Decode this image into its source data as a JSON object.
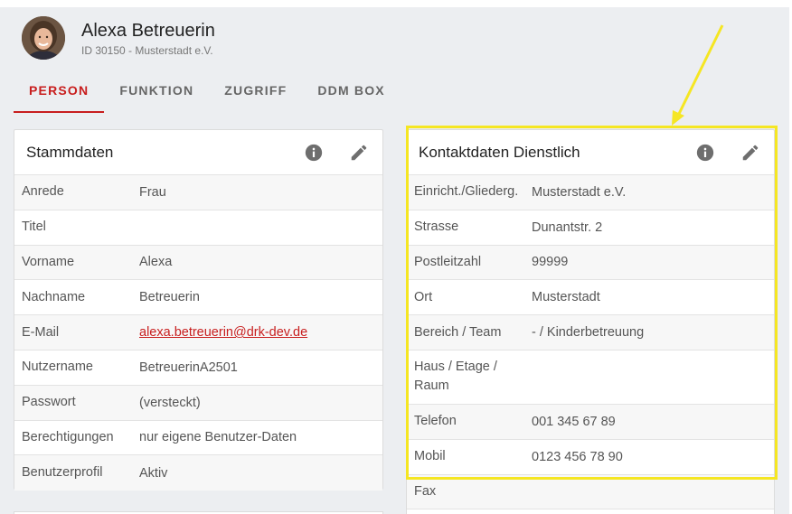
{
  "user": {
    "name": "Alexa Betreuerin",
    "subtitle": "ID 30150 - Musterstadt e.V."
  },
  "tabs": [
    {
      "label": "PERSON",
      "active": true
    },
    {
      "label": "FUNKTION",
      "active": false
    },
    {
      "label": "ZUGRIFF",
      "active": false
    },
    {
      "label": "DDM BOX",
      "active": false
    }
  ],
  "stammdaten": {
    "title": "Stammdaten",
    "icons": [
      "info-icon",
      "edit-icon"
    ],
    "rows": [
      {
        "label": "Anrede",
        "value": "Frau"
      },
      {
        "label": "Titel",
        "value": ""
      },
      {
        "label": "Vorname",
        "value": "Alexa"
      },
      {
        "label": "Nachname",
        "value": "Betreuerin"
      },
      {
        "label": "E-Mail",
        "value": "alexa.betreuerin@drk-dev.de"
      },
      {
        "label": "Nutzername",
        "value": "BetreuerinA2501"
      },
      {
        "label": "Passwort",
        "value": "(versteckt)"
      },
      {
        "label": "Berechtigungen",
        "value": "nur eigene Benutzer-Daten"
      },
      {
        "label": "Benutzerprofil",
        "value": "Aktiv"
      }
    ]
  },
  "kontaktdaten": {
    "title": "Kontaktdaten Dienstlich",
    "icons": [
      "info-icon",
      "edit-icon"
    ],
    "rows": [
      {
        "label": "Einricht./Gliederg.",
        "value": "Musterstadt e.V."
      },
      {
        "label": "Strasse",
        "value": "Dunantstr. 2"
      },
      {
        "label": "Postleitzahl",
        "value": "99999"
      },
      {
        "label": "Ort",
        "value": "Musterstadt"
      },
      {
        "label": "Bereich / Team",
        "value": "- / Kinderbetreuung"
      },
      {
        "label": "Haus / Etage / Raum",
        "value": ""
      },
      {
        "label": "Telefon",
        "value": "001 345 67 89"
      },
      {
        "label": "Mobil",
        "value": "0123 456 78 90"
      },
      {
        "label": "Fax",
        "value": ""
      }
    ]
  },
  "colors": {
    "accent": "#c81e1e",
    "highlight": "#f5e623",
    "page_background": "#eceef1"
  }
}
